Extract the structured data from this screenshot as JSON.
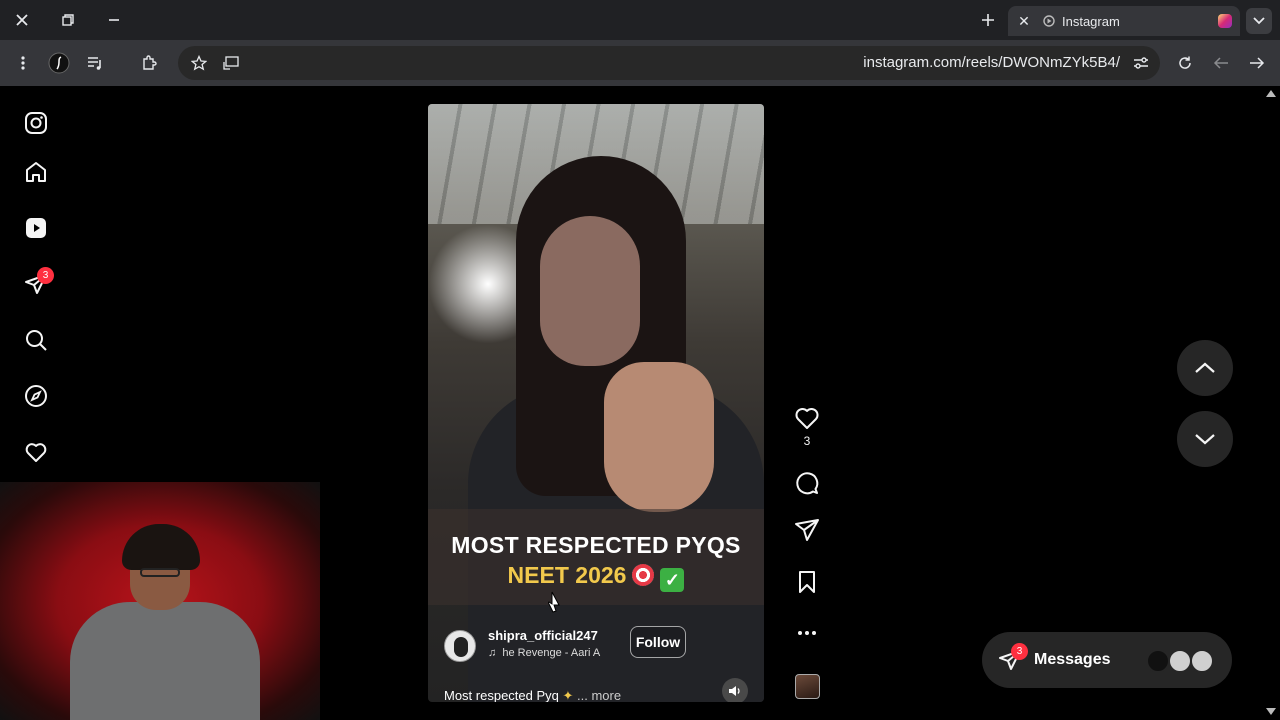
{
  "browser": {
    "tab_title": "Instagram",
    "url": "instagram.com/reels/DWONmZYk5B4/"
  },
  "sidebar": {
    "notification_badge": "3"
  },
  "reel": {
    "caption_line1": "MOST RESPECTED PYQS",
    "caption_line2": "NEET 2026",
    "username": "shipra_official247",
    "music": "he Revenge - Aari A",
    "follow_label": "Follow",
    "description": "Most respected Pyq",
    "more_label": "... more",
    "like_count": "3"
  },
  "messages": {
    "label": "Messages",
    "badge": "3"
  },
  "colors": {
    "badge": "#ff3040",
    "caption_yellow": "#f2c94c"
  }
}
